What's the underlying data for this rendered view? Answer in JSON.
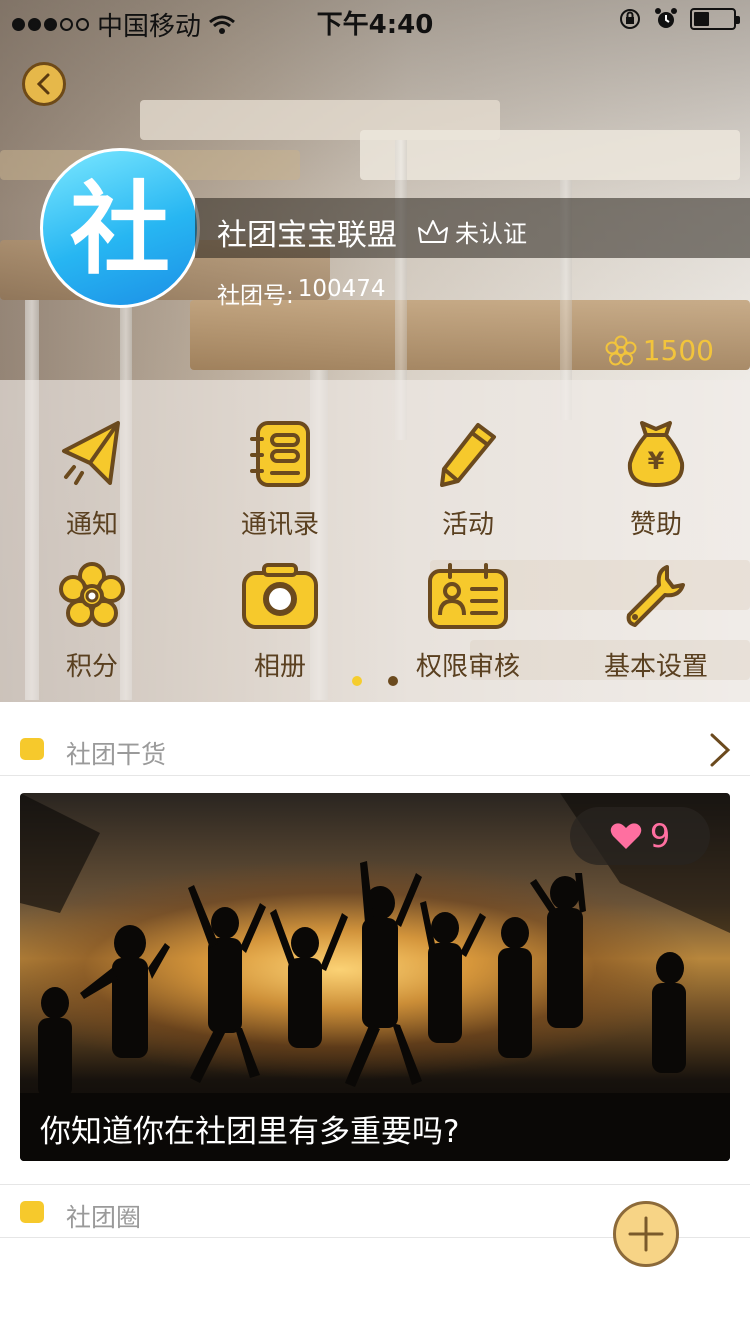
{
  "status_bar": {
    "carrier": "中国移动",
    "time": "下午4:40",
    "battery_level": 0.35
  },
  "profile": {
    "avatar_text": "社",
    "name": "社团宝宝联盟",
    "cert_status": "未认证",
    "id_label": "社团号:",
    "id_value": "100474",
    "points": "1500"
  },
  "menu": {
    "items": [
      {
        "label": "通知",
        "icon": "paper-plane-icon"
      },
      {
        "label": "通讯录",
        "icon": "address-book-icon"
      },
      {
        "label": "活动",
        "icon": "pencil-icon"
      },
      {
        "label": "赞助",
        "icon": "money-bag-icon"
      },
      {
        "label": "积分",
        "icon": "flower-icon"
      },
      {
        "label": "相册",
        "icon": "camera-icon"
      },
      {
        "label": "权限审核",
        "icon": "id-card-icon"
      },
      {
        "label": "基本设置",
        "icon": "wrench-icon"
      }
    ],
    "pages": 2,
    "current_page": 1
  },
  "sections": {
    "dry_goods": {
      "title": "社团干货"
    },
    "circle": {
      "title": "社团圈"
    }
  },
  "article": {
    "title": "你知道你在社团里有多重要吗?",
    "likes": "9"
  },
  "colors": {
    "accent": "#f6c92c",
    "icon_stroke": "#6b4a1e",
    "like": "#ff6fa0"
  }
}
